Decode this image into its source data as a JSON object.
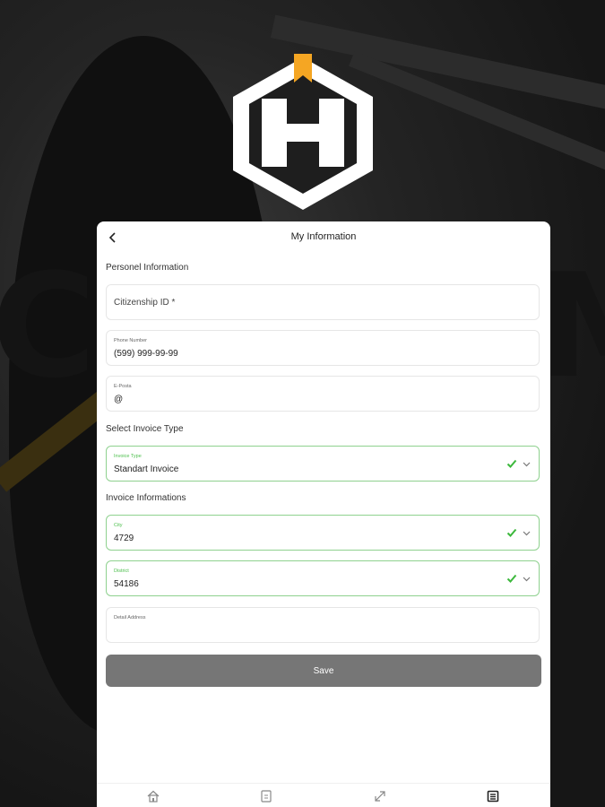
{
  "background": {
    "description_color": "#1a1a1a"
  },
  "logo": {
    "icon": "hexagon-h-logo",
    "accent_color": "#f5a623"
  },
  "header": {
    "title": "My Information",
    "back_icon": "chevron-left-icon"
  },
  "personal": {
    "section_title": "Personel Information",
    "citizenship": {
      "placeholder": "Citizenship ID *"
    },
    "phone": {
      "label": "Phone Number",
      "value": "(599) 999-99-99"
    },
    "email": {
      "label": "E-Posta",
      "value": "@"
    }
  },
  "invoice_type": {
    "section_title": "Select Invoice Type",
    "field": {
      "label": "Invoice Type",
      "value": "Standart Invoice"
    }
  },
  "invoice_info": {
    "section_title": "Invoice Informations",
    "city": {
      "label": "City",
      "value": "4729"
    },
    "district": {
      "label": "District",
      "value": "54186"
    },
    "address": {
      "label": "Detail Address",
      "value": ""
    }
  },
  "save_label": "Save",
  "colors": {
    "valid_border": "#8fd18f",
    "check": "#3cb83c",
    "save_bg": "#767676"
  },
  "nav": [
    "home-icon",
    "document-icon",
    "expand-icon",
    "list-icon"
  ]
}
